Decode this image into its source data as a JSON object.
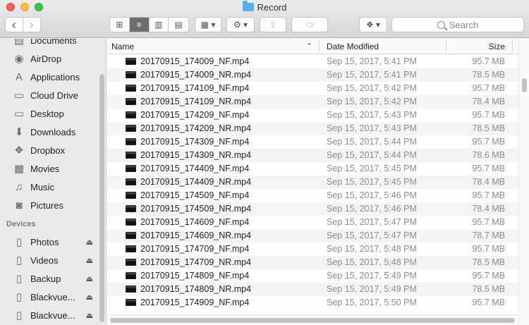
{
  "window": {
    "title": "Record"
  },
  "toolbar": {
    "back_label": "‹",
    "forward_label": "›",
    "view_icons": [
      "⊞",
      "≡",
      "▥",
      "▤"
    ],
    "arrange_label": "▦ ▾",
    "action_label": "⚙ ▾",
    "share_label": "⇪",
    "tag_label": "⬭",
    "dropbox_label": "❖ ▾",
    "search_placeholder": "Search"
  },
  "sidebar": {
    "favorites": [
      {
        "label": "Documents",
        "icon": "documents-icon",
        "glyph": "▤"
      },
      {
        "label": "AirDrop",
        "icon": "airdrop-icon",
        "glyph": "◉"
      },
      {
        "label": "Applications",
        "icon": "applications-icon",
        "glyph": "A"
      },
      {
        "label": "Cloud Drive",
        "icon": "folder-icon",
        "glyph": "▭"
      },
      {
        "label": "Desktop",
        "icon": "desktop-icon",
        "glyph": "▭"
      },
      {
        "label": "Downloads",
        "icon": "downloads-icon",
        "glyph": "⬇"
      },
      {
        "label": "Dropbox",
        "icon": "dropbox-icon",
        "glyph": "❖"
      },
      {
        "label": "Movies",
        "icon": "movies-icon",
        "glyph": "▦"
      },
      {
        "label": "Music",
        "icon": "music-icon",
        "glyph": "♫"
      },
      {
        "label": "Pictures",
        "icon": "pictures-icon",
        "glyph": "◙"
      }
    ],
    "devices_heading": "Devices",
    "devices": [
      {
        "label": "Photos",
        "icon": "drive-icon",
        "glyph": "▯",
        "eject": "⏏"
      },
      {
        "label": "Videos",
        "icon": "drive-icon",
        "glyph": "▯",
        "eject": "⏏"
      },
      {
        "label": "Backup",
        "icon": "drive-icon",
        "glyph": "▯",
        "eject": "⏏"
      },
      {
        "label": "Blackvue...",
        "icon": "drive-icon",
        "glyph": "▯",
        "eject": "⏏"
      },
      {
        "label": "Blackvue...",
        "icon": "drive-icon",
        "glyph": "▯",
        "eject": "⏏"
      }
    ]
  },
  "columns": {
    "name": "Name",
    "date": "Date Modified",
    "size": "Size",
    "sort_indicator": "⌃"
  },
  "files": [
    {
      "name": "20170915_174009_NF.mp4",
      "date": "Sep 15, 2017, 5:41 PM",
      "size": "95.7 MB"
    },
    {
      "name": "20170915_174009_NR.mp4",
      "date": "Sep 15, 2017, 5:41 PM",
      "size": "78.5 MB"
    },
    {
      "name": "20170915_174109_NF.mp4",
      "date": "Sep 15, 2017, 5:42 PM",
      "size": "95.7 MB"
    },
    {
      "name": "20170915_174109_NR.mp4",
      "date": "Sep 15, 2017, 5:42 PM",
      "size": "78.4 MB"
    },
    {
      "name": "20170915_174209_NF.mp4",
      "date": "Sep 15, 2017, 5:43 PM",
      "size": "95.7 MB"
    },
    {
      "name": "20170915_174209_NR.mp4",
      "date": "Sep 15, 2017, 5:43 PM",
      "size": "78.5 MB"
    },
    {
      "name": "20170915_174309_NF.mp4",
      "date": "Sep 15, 2017, 5:44 PM",
      "size": "95.7 MB"
    },
    {
      "name": "20170915_174309_NR.mp4",
      "date": "Sep 15, 2017, 5:44 PM",
      "size": "78.6 MB"
    },
    {
      "name": "20170915_174409_NF.mp4",
      "date": "Sep 15, 2017, 5:45 PM",
      "size": "95.7 MB"
    },
    {
      "name": "20170915_174409_NR.mp4",
      "date": "Sep 15, 2017, 5:45 PM",
      "size": "78.4 MB"
    },
    {
      "name": "20170915_174509_NF.mp4",
      "date": "Sep 15, 2017, 5:46 PM",
      "size": "95.7 MB"
    },
    {
      "name": "20170915_174509_NR.mp4",
      "date": "Sep 15, 2017, 5:46 PM",
      "size": "78.4 MB"
    },
    {
      "name": "20170915_174609_NF.mp4",
      "date": "Sep 15, 2017, 5:47 PM",
      "size": "95.7 MB"
    },
    {
      "name": "20170915_174609_NR.mp4",
      "date": "Sep 15, 2017, 5:47 PM",
      "size": "78.7 MB"
    },
    {
      "name": "20170915_174709_NF.mp4",
      "date": "Sep 15, 2017, 5:48 PM",
      "size": "95.7 MB"
    },
    {
      "name": "20170915_174709_NR.mp4",
      "date": "Sep 15, 2017, 5:48 PM",
      "size": "78.5 MB"
    },
    {
      "name": "20170915_174809_NF.mp4",
      "date": "Sep 15, 2017, 5:49 PM",
      "size": "95.7 MB"
    },
    {
      "name": "20170915_174809_NR.mp4",
      "date": "Sep 15, 2017, 5:49 PM",
      "size": "78.5 MB"
    },
    {
      "name": "20170915_174909_NF.mp4",
      "date": "Sep 15, 2017, 5:50 PM",
      "size": "95.7 MB"
    }
  ]
}
